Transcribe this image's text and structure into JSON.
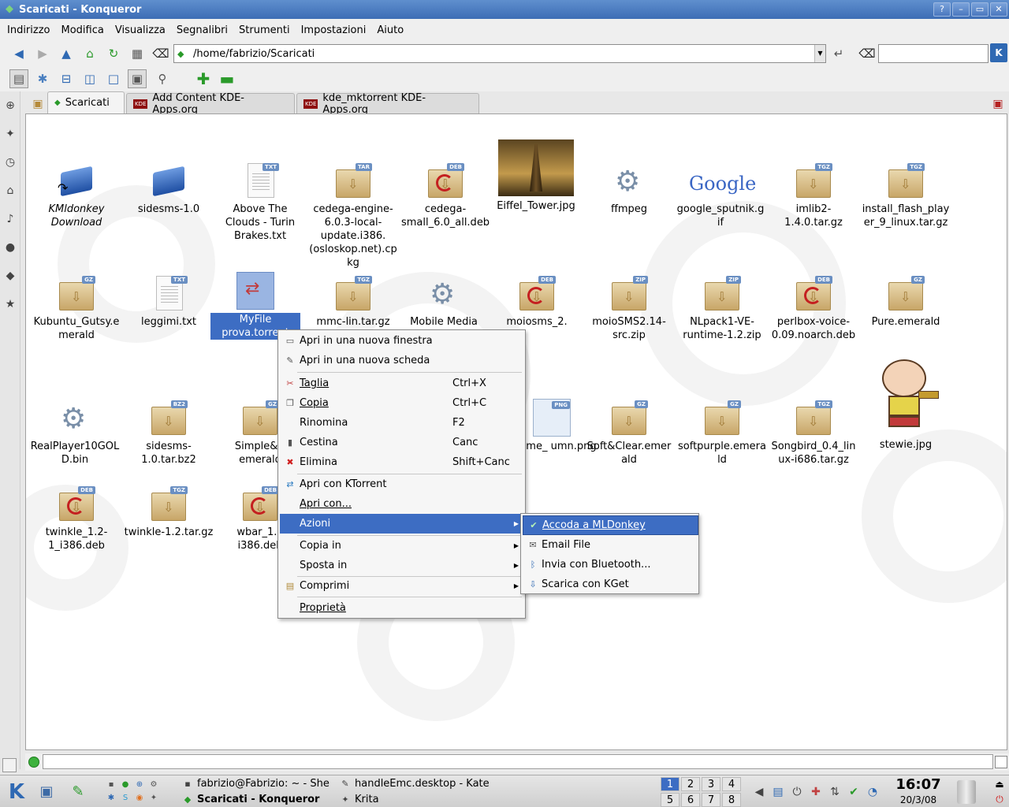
{
  "window": {
    "title": "Scaricati - Konqueror",
    "buttons": [
      "?",
      "–",
      "▭",
      "✕"
    ]
  },
  "menubar": [
    "Indirizzo",
    "Modifica",
    "Visualizza",
    "Segnalibri",
    "Strumenti",
    "Impostazioni",
    "Aiuto"
  ],
  "location": {
    "path": "/home/fabrizio/Scaricati"
  },
  "tabs": [
    {
      "label": "Scaricati",
      "icon": "folder-icon"
    },
    {
      "label": "Add Content KDE-Apps.org",
      "icon": "KDE"
    },
    {
      "label": "kde_mktorrent KDE-Apps.org",
      "icon": "KDE"
    }
  ],
  "files": [
    {
      "name": "KMldonkey Download",
      "type": "link",
      "italic": true
    },
    {
      "name": "sidesms-1.0",
      "type": "folder"
    },
    {
      "name": "Above The Clouds - Turin Brakes.txt",
      "type": "txt",
      "badge": "TXT"
    },
    {
      "name": "cedega-engine-6.0.3-local-update.i386.(osloskop.net).cpkg",
      "type": "pkg",
      "badge": "TAR"
    },
    {
      "name": "cedega-small_6.0_all.deb",
      "type": "deb",
      "badge": "DEB"
    },
    {
      "name": "Eiffel_Tower.jpg",
      "type": "image"
    },
    {
      "name": "ffmpeg",
      "type": "exec"
    },
    {
      "name": "google_sputnik.gif",
      "type": "image",
      "badge_text": "Google"
    },
    {
      "name": "imlib2-1.4.0.tar.gz",
      "type": "pkg",
      "badge": "TGZ"
    },
    {
      "name": "install_flash_player_9_linux.tar.gz",
      "type": "pkg",
      "badge": "TGZ"
    },
    {
      "name": "Kubuntu_Gutsy.emerald",
      "type": "pkg",
      "badge": "GZ"
    },
    {
      "name": "leggimi.txt",
      "type": "txt",
      "badge": "TXT"
    },
    {
      "name": "MyFile prova.torrent",
      "type": "torrent",
      "selected": true
    },
    {
      "name": "mmc-lin.tar.gz",
      "type": "pkg",
      "badge": "TGZ"
    },
    {
      "name": "Mobile Media",
      "type": "exec"
    },
    {
      "name": "moiosms_2.",
      "type": "deb",
      "badge": "DEB"
    },
    {
      "name": "moioSMS2.14-src.zip",
      "type": "pkg",
      "badge": "ZIP"
    },
    {
      "name": "NLpack1-VE-runtime-1.2.zip",
      "type": "pkg",
      "badge": "ZIP"
    },
    {
      "name": "perlbox-voice-0.09.noarch.deb",
      "type": "deb",
      "badge": "DEB"
    },
    {
      "name": "Pure.emerald",
      "type": "pkg",
      "badge": "GZ"
    },
    {
      "name": "RealPlayer10GOLD.bin",
      "type": "exec"
    },
    {
      "name": "sidesms-1.0.tar.bz2",
      "type": "pkg",
      "badge": "BZ2"
    },
    {
      "name": "Simple&N emerald",
      "type": "pkg",
      "badge": "GZ"
    },
    {
      "name": "ydome_ umn.png",
      "type": "image",
      "badge": "PNG"
    },
    {
      "name": "Soft&Clear.emerald",
      "type": "pkg",
      "badge": "GZ"
    },
    {
      "name": "softpurple.emerald",
      "type": "pkg",
      "badge": "GZ"
    },
    {
      "name": "Songbird_0.4_linux-i686.tar.gz",
      "type": "pkg",
      "badge": "TGZ"
    },
    {
      "name": "stewie.jpg",
      "type": "image"
    },
    {
      "name": "twinkle_1.2-1_i386.deb",
      "type": "deb",
      "badge": "DEB"
    },
    {
      "name": "twinkle-1.2.tar.gz",
      "type": "pkg",
      "badge": "TGZ"
    },
    {
      "name": "wbar_1.3 i386.deb",
      "type": "deb",
      "badge": "DEB"
    }
  ],
  "context_menu": {
    "items": [
      {
        "label": "Apri in una nuova finestra",
        "icon": "window-new-icon"
      },
      {
        "label": "Apri in una nuova scheda",
        "icon": "tab-new-icon"
      },
      {
        "label": "Taglia",
        "shortcut": "Ctrl+X",
        "icon": "scissors-icon"
      },
      {
        "label": "Copia",
        "shortcut": "Ctrl+C",
        "icon": "copy-icon"
      },
      {
        "label": "Rinomina",
        "shortcut": "F2"
      },
      {
        "label": "Cestina",
        "shortcut": "Canc",
        "icon": "trash-icon"
      },
      {
        "label": "Elimina",
        "shortcut": "Shift+Canc",
        "icon": "delete-icon"
      },
      {
        "label": "Apri con KTorrent",
        "icon": "ktorrent-icon"
      },
      {
        "label": "Apri con..."
      },
      {
        "label": "Azioni",
        "submenu": true
      },
      {
        "label": "Copia in",
        "submenu": true
      },
      {
        "label": "Sposta in",
        "submenu": true
      },
      {
        "label": "Comprimi",
        "submenu": true,
        "icon": "archive-icon"
      },
      {
        "label": "Proprietà"
      }
    ]
  },
  "submenu": {
    "items": [
      {
        "label": "Accoda a MLDonkey",
        "icon": "mldonkey-icon"
      },
      {
        "label": "Email File",
        "icon": "mail-icon"
      },
      {
        "label": "Invia con Bluetooth...",
        "icon": "bluetooth-icon"
      },
      {
        "label": "Scarica con KGet",
        "icon": "kget-icon"
      }
    ]
  },
  "taskbar": {
    "tasks": [
      {
        "label": "fabrizio@Fabrizio: ~ - She",
        "icon": "terminal-icon"
      },
      {
        "label": "handleEmc.desktop - Kate",
        "icon": "kate-icon"
      },
      {
        "label": "Scaricati - Konqueror",
        "icon": "konqueror-icon",
        "active": true
      },
      {
        "label": "Krita",
        "icon": "krita-icon"
      }
    ],
    "desktops": [
      "1",
      "2",
      "3",
      "4",
      "5",
      "6",
      "7",
      "8"
    ],
    "current_desktop": "1",
    "clock": {
      "time": "16:07",
      "date": "20/3/08"
    }
  }
}
